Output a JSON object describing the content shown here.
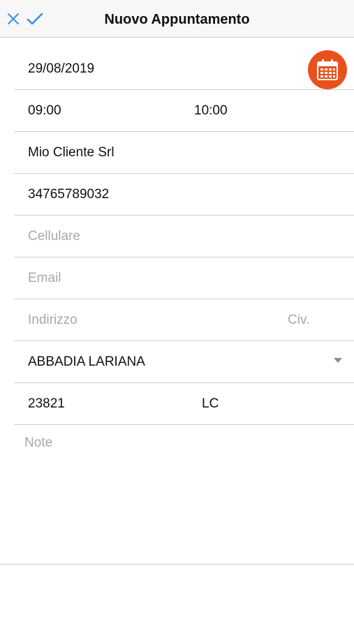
{
  "navbar": {
    "title": "Nuovo Appuntamento",
    "close_icon": "close-icon",
    "confirm_icon": "checkmark-icon",
    "accent_color": "#3a8ee6"
  },
  "form": {
    "date": {
      "value": "29/08/2019",
      "calendar_icon": "calendar-icon",
      "calendar_color": "#e8511e"
    },
    "time": {
      "start": "09:00",
      "end": "10:00"
    },
    "client": {
      "value": "Mio Cliente Srl"
    },
    "phone": {
      "value": "34765789032"
    },
    "mobile": {
      "placeholder": "Cellulare"
    },
    "email": {
      "placeholder": "Email"
    },
    "address": {
      "placeholder": "Indirizzo",
      "number_placeholder": "Civ."
    },
    "city": {
      "value": "ABBADIA LARIANA",
      "dropdown_icon": "chevron-down-icon"
    },
    "zip_province": {
      "zip": "23821",
      "province": "LC"
    },
    "notes": {
      "placeholder": "Note"
    }
  }
}
